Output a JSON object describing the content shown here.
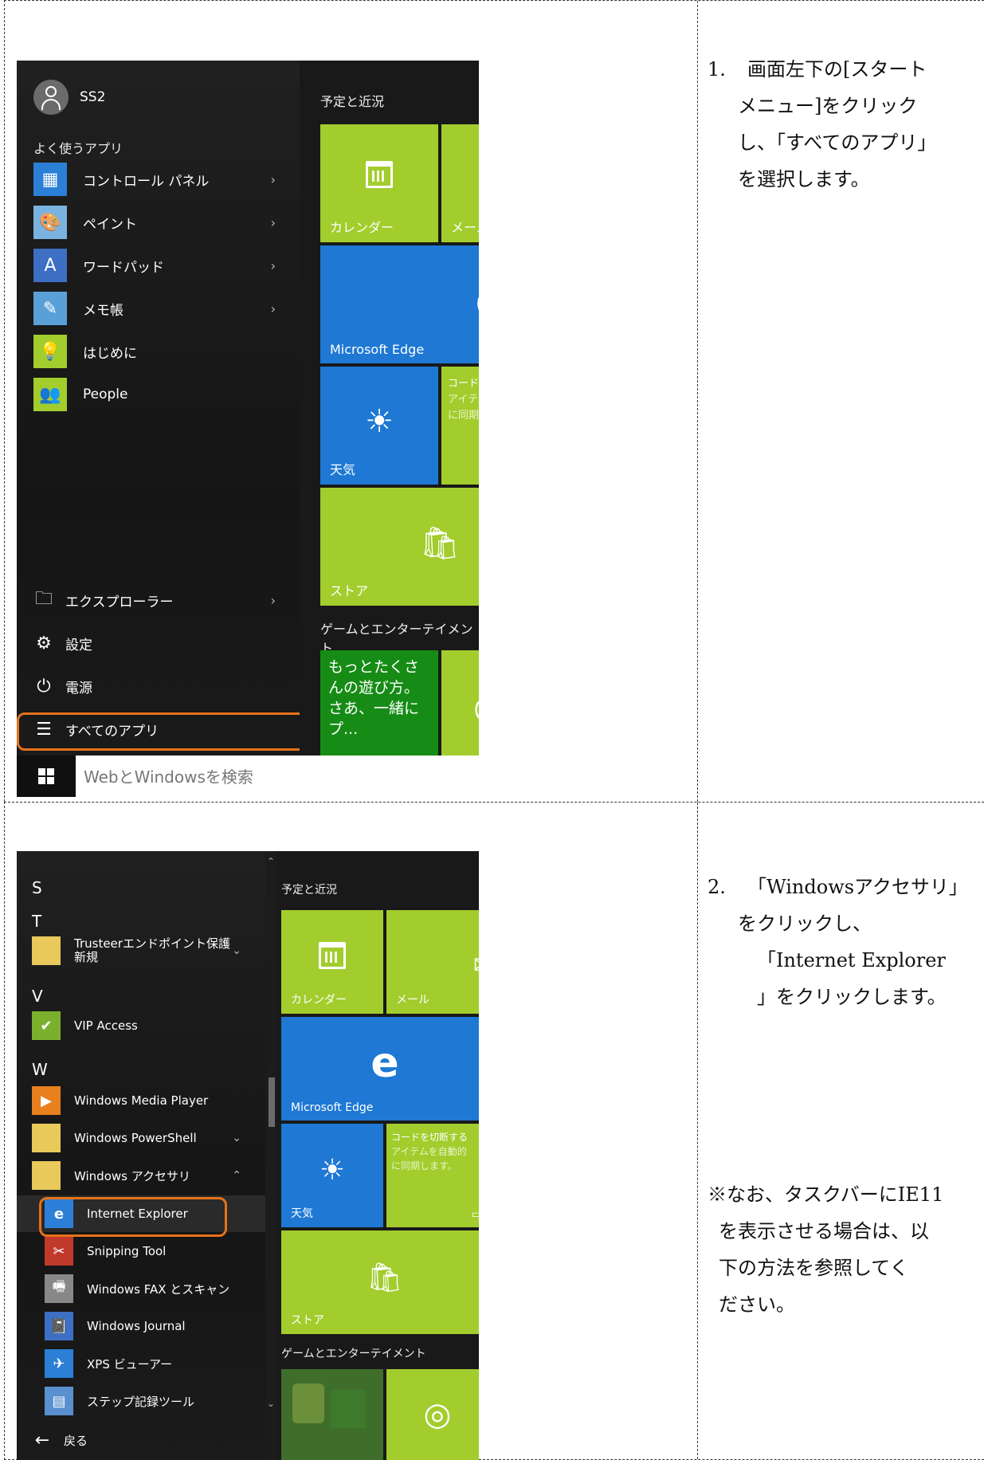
{
  "step1": {
    "number": "1.",
    "text_lines": [
      "画面左下の[スタート",
      "メニュー]をクリック",
      "し、「すべてのアプリ」",
      "を選択します。"
    ]
  },
  "step2": {
    "number": "2.",
    "text_lines": [
      "「Windowsアクセサリ」",
      "をクリックし、",
      "「Internet Explorer",
      "」をクリックします。"
    ],
    "note_lines": [
      "※なお、タスクバーにIE11",
      "を表示させる場合は、以",
      "下の方法を参照してく",
      "ださい。"
    ]
  },
  "shot1": {
    "user_name": "SS2",
    "frequent_label": "よく使うアプリ",
    "apps": [
      {
        "label": "コントロール パネル",
        "icon": "control-panel-icon",
        "chevron": "›"
      },
      {
        "label": "ペイント",
        "icon": "paint-icon",
        "chevron": "›"
      },
      {
        "label": "ワードパッド",
        "icon": "wordpad-icon",
        "chevron": "›"
      },
      {
        "label": "メモ帳",
        "icon": "notepad-icon",
        "chevron": "›"
      },
      {
        "label": "はじめに",
        "icon": "get-started-icon",
        "chevron": ""
      },
      {
        "label": "People",
        "icon": "people-icon",
        "chevron": ""
      }
    ],
    "explorer": {
      "label": "エクスプローラー",
      "chevron": "›"
    },
    "settings_label": "設定",
    "power_label": "電源",
    "all_apps_label": "すべてのアプリ",
    "search_placeholder": "WebとWindowsを検索",
    "group1_title": "予定と近況",
    "group2_title": "ゲームとエンターテイメント",
    "tiles": {
      "calendar": "カレンダー",
      "mail": "メール",
      "edge": "Microsoft Edge",
      "weather": "天気",
      "phone_line1": "コードを切",
      "phone_line2": "アイテムを",
      "phone_line3": "に同期し",
      "store": "ストア",
      "xbox": "もっとたくさんの遊び方。さあ、一緒にプ..."
    }
  },
  "shot2": {
    "group1_title": "予定と近況",
    "group2_title": "ゲームとエンターテイメント",
    "letters": [
      "S",
      "T",
      "V",
      "W"
    ],
    "trusteer": {
      "label": "Trusteerエンドポイント保護",
      "badge": "新規",
      "chevron": "⌄"
    },
    "vip": "VIP Access",
    "wmp": "Windows Media Player",
    "powershell": {
      "label": "Windows PowerShell",
      "chevron": "⌄"
    },
    "accessories": {
      "label": "Windows アクセサリ",
      "chevron": "⌃"
    },
    "sub_apps": [
      "Internet Explorer",
      "Snipping Tool",
      "Windows FAX とスキャン",
      "Windows Journal",
      "XPS ビューアー",
      "ステップ記録ツール"
    ],
    "back_label": "戻る",
    "tiles": {
      "calendar": "カレンダー",
      "mail": "メール",
      "edge": "Microsoft Edge",
      "weather": "天気",
      "phone_line1": "コードを切断する",
      "phone_line2": "アイテムを自動的",
      "phone_line3": "に同期します。",
      "store": "ストア"
    }
  },
  "colors": {
    "accent_green": "#a2cd2d",
    "edge_blue": "#1e78d4",
    "highlight_orange": "#e6721a"
  }
}
